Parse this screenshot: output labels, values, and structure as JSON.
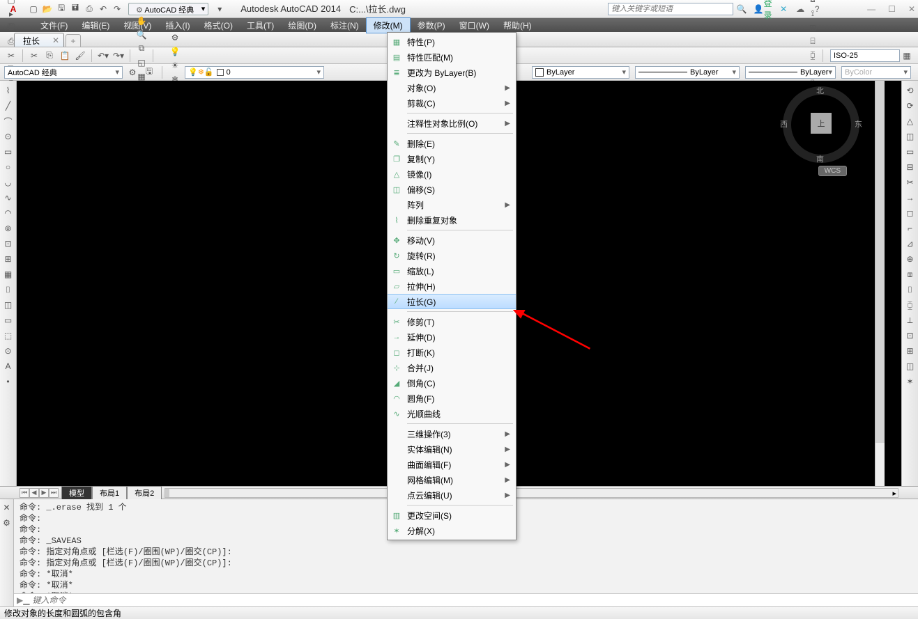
{
  "title": {
    "app": "Autodesk AutoCAD 2014",
    "doc": "C:...\\拉长.dwg"
  },
  "qat_workspace": "AutoCAD 经典",
  "search_placeholder": "键入关键字或短语",
  "signin": "登录",
  "menubar": [
    "文件(F)",
    "编辑(E)",
    "视图(V)",
    "插入(I)",
    "格式(O)",
    "工具(T)",
    "绘图(D)",
    "标注(N)",
    "修改(M)",
    "参数(P)",
    "窗口(W)",
    "帮助(H)"
  ],
  "menubar_active": 8,
  "doctab": "拉长",
  "workspace_selector": "AutoCAD 经典",
  "layer_current": "0",
  "prop_color": "ByLayer",
  "prop_ltype": "ByLayer",
  "prop_lweight": "ByLayer",
  "prop_plot": "ByColor",
  "dim_style": "ISO-25",
  "navcube": {
    "top": "上",
    "n": "北",
    "s": "南",
    "e": "东",
    "w": "西",
    "wcs": "WCS"
  },
  "layout_tabs": [
    "模型",
    "布局1",
    "布局2"
  ],
  "cmd_history": "命令: _.erase 找到 1 个\n命令:\n命令:\n命令: _SAVEAS\n命令: 指定对角点或 [栏选(F)/圈围(WP)/圈交(CP)]:\n命令: 指定对角点或 [栏选(F)/圈围(WP)/圈交(CP)]:\n命令: *取消*\n命令: *取消*\n命令: *取消*",
  "cmd_placeholder": "键入命令",
  "statusbar": "修改对象的长度和圆弧的包含角",
  "dropdown": {
    "groups": [
      [
        {
          "t": "特性(P)",
          "ico": "▦"
        },
        {
          "t": "特性匹配(M)",
          "ico": "▤"
        },
        {
          "t": "更改为 ByLayer(B)",
          "ico": "≣"
        },
        {
          "t": "对象(O)",
          "sub": true
        },
        {
          "t": "剪裁(C)",
          "sub": true
        }
      ],
      [
        {
          "t": "注释性对象比例(O)",
          "sub": true
        }
      ],
      [
        {
          "t": "删除(E)",
          "ico": "✎"
        },
        {
          "t": "复制(Y)",
          "ico": "❐"
        },
        {
          "t": "镜像(I)",
          "ico": "△"
        },
        {
          "t": "偏移(S)",
          "ico": "◫"
        },
        {
          "t": "阵列",
          "sub": true
        },
        {
          "t": "删除重复对象",
          "ico": "⌇"
        }
      ],
      [
        {
          "t": "移动(V)",
          "ico": "✥"
        },
        {
          "t": "旋转(R)",
          "ico": "↻"
        },
        {
          "t": "缩放(L)",
          "ico": "▭"
        },
        {
          "t": "拉伸(H)",
          "ico": "▱"
        },
        {
          "t": "拉长(G)",
          "ico": "⁄",
          "hl": true
        }
      ],
      [
        {
          "t": "修剪(T)",
          "ico": "✂"
        },
        {
          "t": "延伸(D)",
          "ico": "→"
        },
        {
          "t": "打断(K)",
          "ico": "◻"
        },
        {
          "t": "合并(J)",
          "ico": "⊹"
        },
        {
          "t": "倒角(C)",
          "ico": "◢"
        },
        {
          "t": "圆角(F)",
          "ico": "◠"
        },
        {
          "t": "光顺曲线",
          "ico": "∿"
        }
      ],
      [
        {
          "t": "三维操作(3)",
          "sub": true
        },
        {
          "t": "实体编辑(N)",
          "sub": true
        },
        {
          "t": "曲面编辑(F)",
          "sub": true
        },
        {
          "t": "网格编辑(M)",
          "sub": true
        },
        {
          "t": "点云编辑(U)",
          "sub": true
        }
      ],
      [
        {
          "t": "更改空间(S)",
          "ico": "▥"
        },
        {
          "t": "分解(X)",
          "ico": "✶"
        }
      ]
    ]
  },
  "toolbar_row1": [
    "▢",
    "▸",
    "🖫",
    "⎙",
    "✂",
    "⎘",
    "⌶",
    "⎌",
    "↷"
  ],
  "toolbar_row1b": [
    "✋",
    "🔍",
    "⧉",
    "◱",
    "▦",
    "▤"
  ],
  "toolbar_row1c": [
    "○",
    "⟲",
    "◐",
    "⧈",
    "⟟",
    "⊞",
    "⌸",
    "⧮",
    "⎔",
    "⌷",
    "⟳",
    "↗",
    "⌐",
    "⟂",
    "⊿"
  ],
  "layerbar_icons": [
    "⚙",
    "💡",
    "☀",
    "❄",
    "🔒",
    "▦"
  ],
  "left_tools": [
    "⌇",
    "╱",
    "⌒",
    "⊙",
    "▭",
    "○",
    "◡",
    "∿",
    "◠",
    "⊚",
    "⊡",
    "⊞",
    "▦",
    "⌷",
    "◫",
    "▭",
    "⬚",
    "⊙",
    "A",
    "•"
  ],
  "right_tools": [
    "⟲",
    "⟳",
    "△",
    "◫",
    "▭",
    "⊟",
    "✂",
    "→",
    "◻",
    "⌐",
    "⊿",
    "⊕",
    "⧈",
    "⌷",
    "⧮",
    "⟂",
    "⊡",
    "⊞",
    "◫",
    "✶"
  ]
}
